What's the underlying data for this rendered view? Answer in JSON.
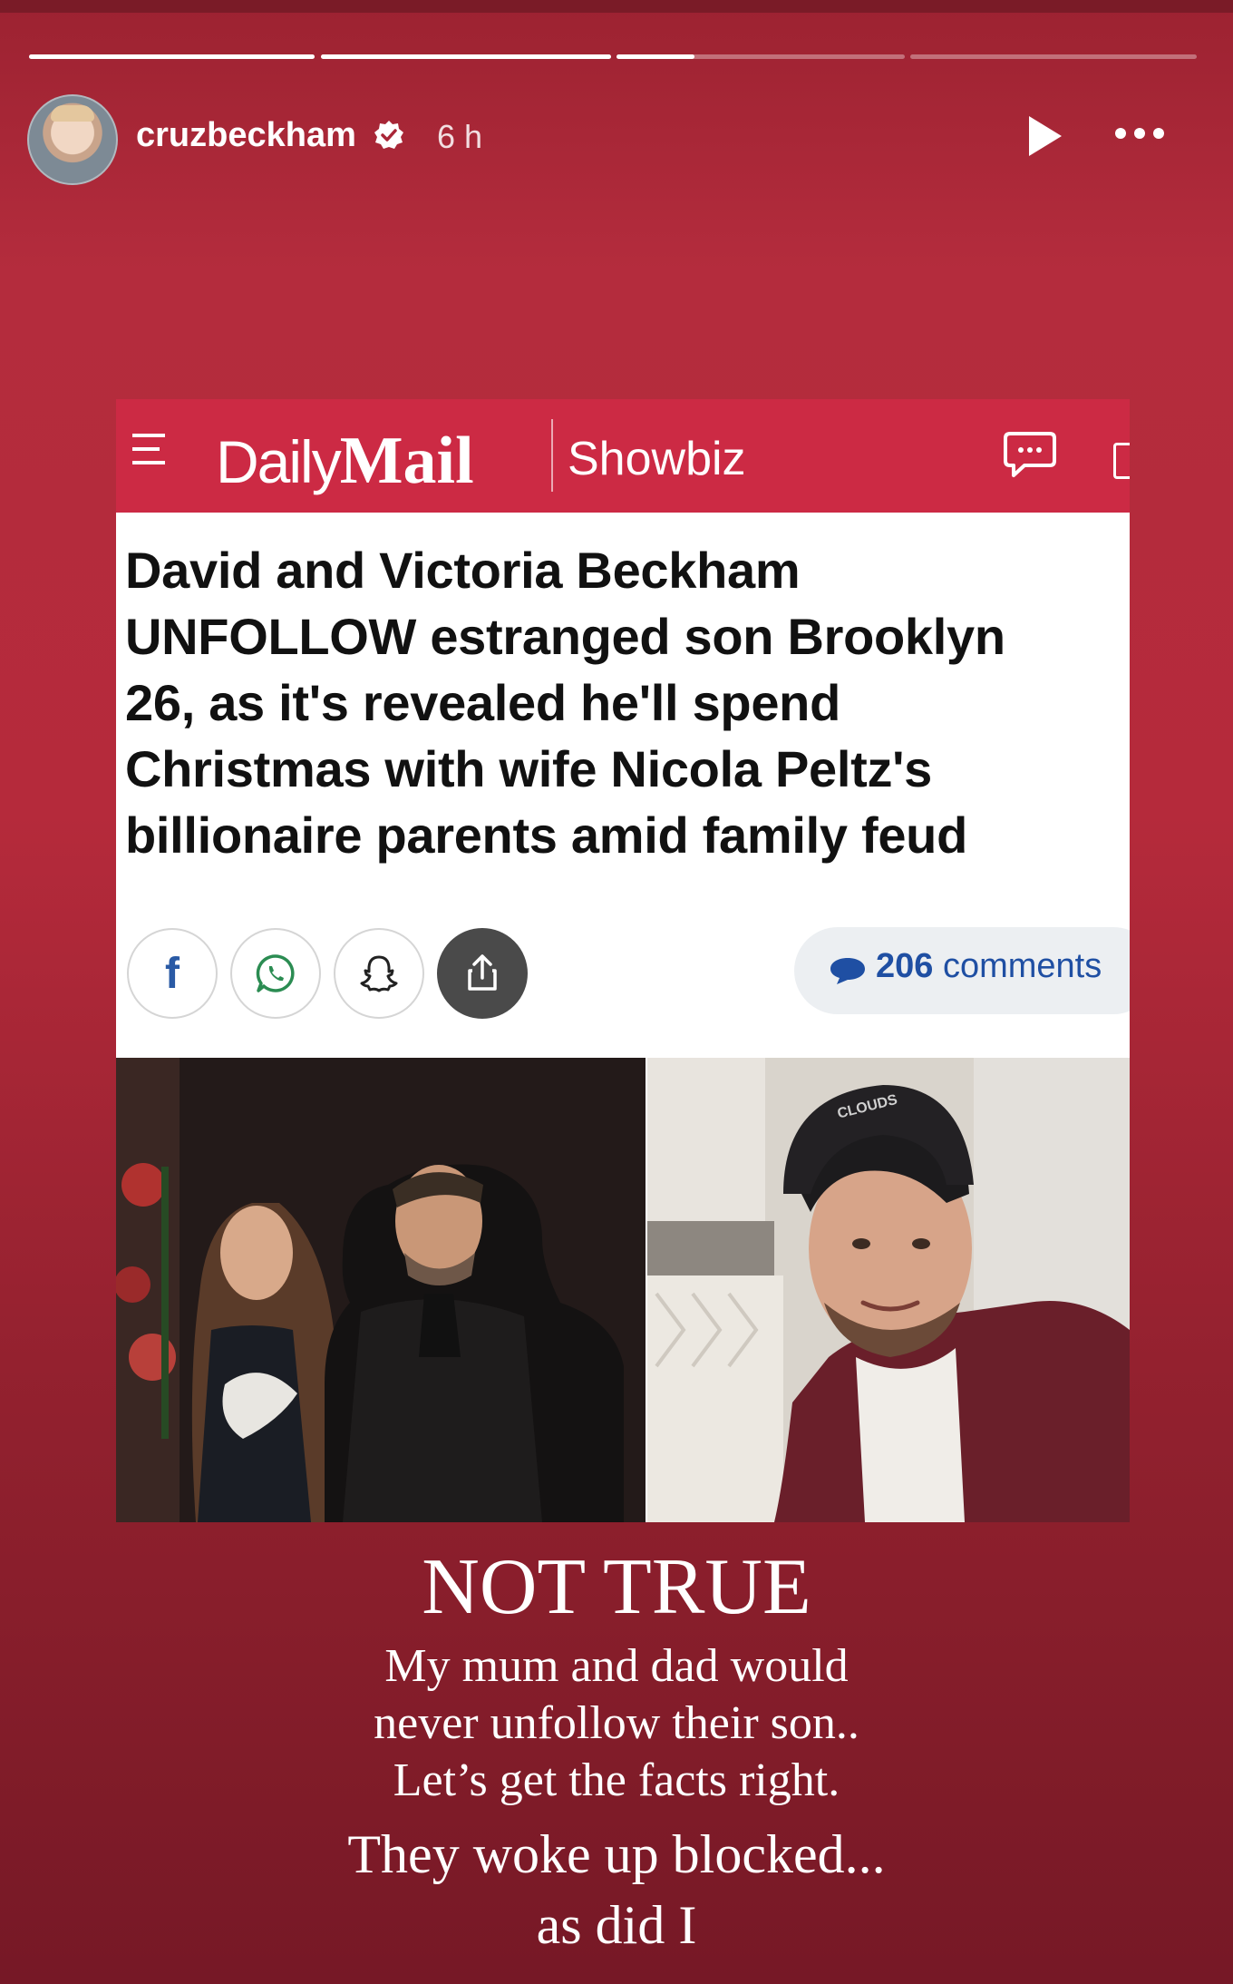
{
  "story": {
    "username": "cruzbeckham",
    "time": "6 h",
    "progress_segments": [
      1.0,
      1.0,
      0.27,
      0.0
    ],
    "colors": {
      "background_top": "#9c2231",
      "background_bottom": "#761826",
      "progress_fill": "#ffffff"
    }
  },
  "article": {
    "brand_light": "Daily",
    "brand_bold": "Mail",
    "section": "Showbiz",
    "header_color": "#cc2a44",
    "headline_lines": [
      "David and Victoria Beckham",
      "UNFOLLOW estranged son Brooklyn",
      "26, as it's revealed he'll spend",
      "Christmas with wife Nicola Peltz's",
      "billionaire parents amid family feud"
    ],
    "share_buttons": [
      "facebook-icon",
      "whatsapp-icon",
      "snapchat-icon",
      "share-icon"
    ],
    "comments_count": "206",
    "comments_label": "comments",
    "cap_text": "CLOUDS"
  },
  "caption": {
    "title": "NOT TRUE",
    "lines": [
      "My mum and dad would",
      "never unfollow their son..",
      "Let’s get the facts right."
    ],
    "closing_lines": [
      "They woke up blocked...",
      "as did I"
    ]
  }
}
